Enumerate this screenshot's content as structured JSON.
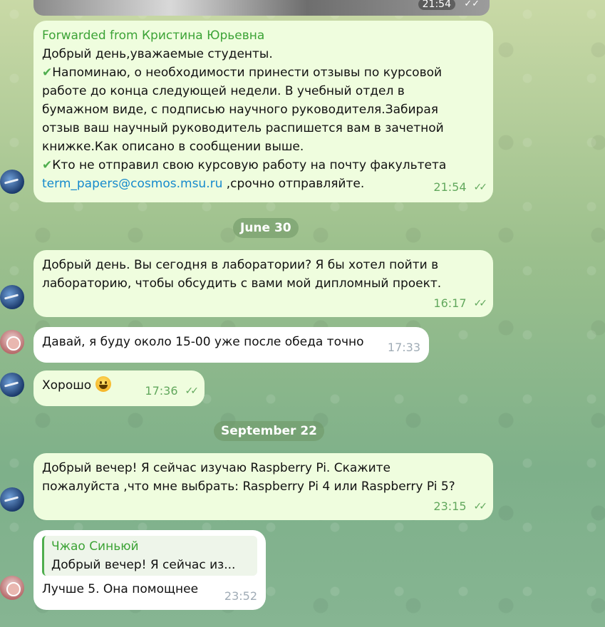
{
  "top_media": {
    "time": "21:54",
    "ticks": "✓✓"
  },
  "msg1": {
    "forward_label": "Forwarded from Кристина Юрьевна",
    "lines": [
      "Добрый день,уважаемые студенты.",
      "Напоминаю, о необходимости принести отзывы по курсовой",
      "работе до конца следующей недели. В учебный отдел в",
      "бумажном виде, с подписью научного руководителя.Забирая",
      "отзыв ваш научный руководитель распишется вам в зачетной",
      "книжке.Как описано в сообщении выше.",
      "Кто не отправил свою курсовую работу на почту факультета"
    ],
    "email": "term_papers@cosmos.msu.ru",
    "after_email": " ,срочно отправляйте.",
    "check_mark": "✔",
    "time": "21:54",
    "ticks": "✓✓"
  },
  "date1": "June 30",
  "msg2": {
    "lines": [
      "Добрый день. Вы сегодня в лаборатории? Я бы хотел пойти в",
      "лабораторию, чтобы обсудить с вами мой дипломный проект."
    ],
    "time": "16:17",
    "ticks": "✓✓"
  },
  "msg3": {
    "text": "Давай, я буду около 15-00 уже после обеда точно",
    "time": "17:33"
  },
  "msg4": {
    "text": "Хорошо",
    "time": "17:36",
    "ticks": "✓✓"
  },
  "date2": "September 22",
  "msg5": {
    "lines": [
      "Добрый вечер! Я сейчас изучаю Raspberry Pi. Скажите",
      "пожалуйста ,что мне выбрать: Raspberry Pi 4 или Raspberry Pi 5?"
    ],
    "time": "23:15",
    "ticks": "✓✓"
  },
  "msg6": {
    "quote_author": "Чжао Синьюй",
    "quote_text": "Добрый вечер! Я сейчас из...",
    "text": "Лучше 5. Она помощнее",
    "time": "23:52"
  },
  "colors": {
    "outgoing_bubble": "#effdde",
    "incoming_bubble": "#ffffff",
    "accent_green": "#3ca336",
    "link": "#168acd"
  }
}
